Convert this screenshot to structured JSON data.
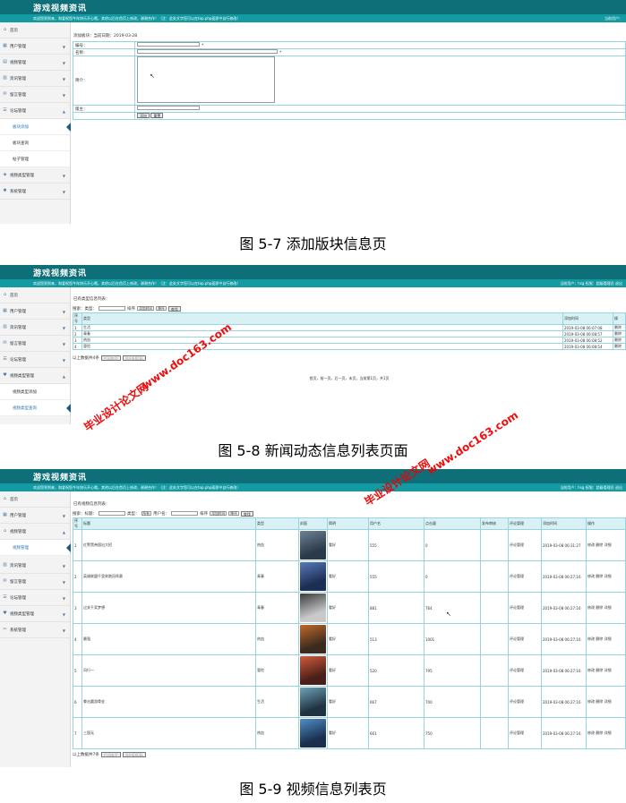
{
  "app": {
    "title": "游戏视频资讯",
    "welcome": "欢迎您到到来，和爱祝您今年快乐开心哦，其他以后在首页上修改，谢谢合作！（注：此处文字您可以在top.php面即中自行修改）",
    "user_short": "当前用户：",
    "user_long": "当前用户：hsg 权限：超级管理员 退出"
  },
  "captions": {
    "fig1": "图 5-7 添加版块信息页",
    "fig2": "图 5-8 新闻动态信息列表页面",
    "fig3": "图 5-9 视频信息列表页"
  },
  "shot1": {
    "sidebar": [
      "首页",
      "用户管理",
      "视频管理",
      "资讯管理",
      "留言管理",
      "论坛管理"
    ],
    "sub": [
      "板块添加",
      "板块查询",
      "帖子管理"
    ],
    "sidebar2": [
      "视频类型管理",
      "系统管理"
    ],
    "crumb": "添加板块：当前日期：2019-03-28",
    "fields": {
      "id": "编号：",
      "name": "名称：",
      "desc": "简介：",
      "owner": "版主："
    },
    "btn_add": "添加",
    "btn_reset": "重置"
  },
  "shot2": {
    "sidebar": [
      "首页",
      "用户管理",
      "资讯管理",
      "留言管理",
      "论坛管理",
      "视频类型管理"
    ],
    "sub": [
      "视频类型添加",
      "视频类型查询"
    ],
    "crumb": "已有类型信息列表：",
    "search": {
      "label": "搜索：类型：",
      "sort": "排序",
      "sort_by": "添加时间",
      "order": "降序",
      "btn": "查找"
    },
    "headers": [
      "序号",
      "类型",
      "添加时间",
      "操"
    ],
    "rows": [
      {
        "no": "1",
        "type": "生活",
        "time": "2019-03-08 06:07:08",
        "op": "删除"
      },
      {
        "no": "2",
        "type": "青春",
        "time": "2019-03-08 06:08:57",
        "op": "删除"
      },
      {
        "no": "3",
        "type": "热血",
        "time": "2019-03-08 06:08:52",
        "op": "删除"
      },
      {
        "no": "4",
        "type": "冒险",
        "time": "2019-03-08 06:08:54",
        "op": "删除"
      }
    ],
    "footer": "以上数据共4条",
    "btn_print": "打印本页",
    "btn_excel": "导出EXCEL",
    "pager": "首页，前一页，后一页，末页，当前第1页，共1页"
  },
  "shot3": {
    "sidebar": [
      "首页",
      "用户管理",
      "视频管理"
    ],
    "sub": [
      "视频管理"
    ],
    "sidebar2": [
      "资讯管理",
      "留言管理",
      "论坛管理",
      "视频类型管理",
      "系统管理"
    ],
    "crumb": "已有视频信息列表：",
    "search": {
      "label": "搜索：标题：",
      "type_label": "类型：",
      "type_val": "所有",
      "user_label": "用户名：",
      "sort": "排序",
      "sort_by": "添加时间",
      "order": "降序",
      "btn": "查找"
    },
    "headers": [
      "序号",
      "标题",
      "类型",
      "封面",
      "简明",
      "用户名",
      "点击量",
      "发布审核",
      "评论管理",
      "添加时间",
      "操作"
    ],
    "rows": [
      {
        "no": "1",
        "title": "红警黑帝国出大招",
        "type": "热血",
        "brief": "看好",
        "user": "555",
        "clicks": "0",
        "review": "评论管理",
        "time": "2019-03-08 06:31:27",
        "op": "修改 删除 详细"
      },
      {
        "no": "2",
        "title": "英雄联盟千里奔跑冠肯赛",
        "type": "青春",
        "brief": "看好",
        "user": "555",
        "clicks": "0",
        "review": "评论管理",
        "time": "2019-03-08 06:27:16",
        "op": "修改 删除 详细"
      },
      {
        "no": "3",
        "title": "过关千奖梦想",
        "type": "青春",
        "brief": "看好",
        "user": "881",
        "clicks": "764",
        "review": "评论管理",
        "time": "2019-03-08 06:27:16",
        "op": "修改 删除 详细"
      },
      {
        "no": "4",
        "title": "最强",
        "type": "热血",
        "brief": "看好",
        "user": "513",
        "clicks": "1001",
        "review": "评论管理",
        "time": "2019-03-08 06:27:16",
        "op": "修改 删除 详细"
      },
      {
        "no": "5",
        "title": "风行一",
        "type": "冒险",
        "brief": "看好",
        "user": "520",
        "clicks": "795",
        "review": "评论管理",
        "time": "2019-03-08 06:27:16",
        "op": "修改 删除 详细"
      },
      {
        "no": "6",
        "title": "拳击圆游骨金",
        "type": "生活",
        "brief": "看好",
        "user": "667",
        "clicks": "700",
        "review": "评论管理",
        "time": "2019-03-08 06:27:16",
        "op": "修改 删除 详细"
      },
      {
        "no": "7",
        "title": "三国无",
        "type": "热血",
        "brief": "看好",
        "user": "661",
        "clicks": "750",
        "review": "评论管理",
        "time": "2019-03-08 06:27:16",
        "op": "修改 删除 详细"
      }
    ],
    "footer": "以上数据共7条",
    "btn_print": "打印本页",
    "btn_excel": "导出EXCEL"
  },
  "watermarks": {
    "url": "www.doc163.com",
    "site": "毕业设计论文网"
  },
  "colors": {
    "header_dark": "#0f6f78",
    "header_bar": "#129ba2",
    "grid_border": "#9ad3e0",
    "watermark": "#e00000"
  }
}
